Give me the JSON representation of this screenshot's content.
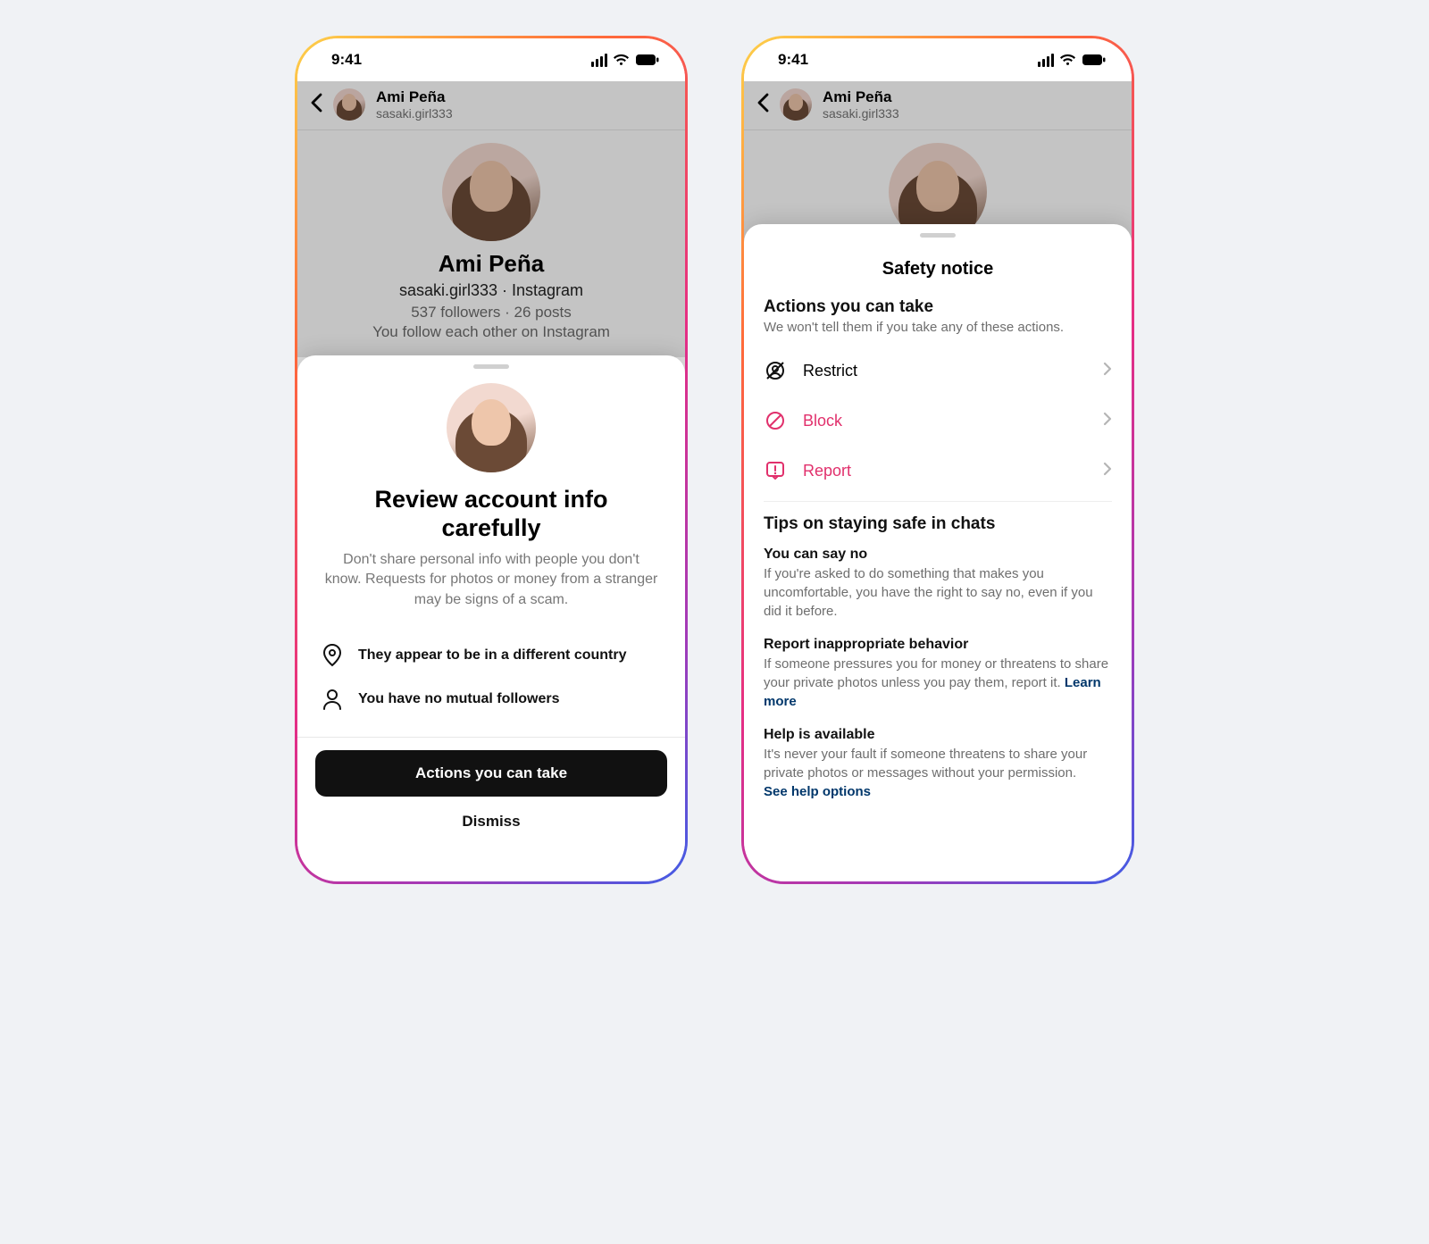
{
  "status": {
    "time": "9:41"
  },
  "profile": {
    "display_name": "Ami Peña",
    "username": "sasaki.girl333",
    "profile_line1": "sasaki.girl333 · Instagram",
    "profile_line2": "537 followers · 26 posts",
    "profile_line3": "You follow each other on Instagram"
  },
  "review_sheet": {
    "title": "Review account info carefully",
    "description": "Don't share personal info with people you don't know. Requests for photos or money from a stranger may be signs of a scam.",
    "facts": [
      "They appear to be in a different country",
      "You have no mutual followers"
    ],
    "primary_button": "Actions you can take",
    "dismiss": "Dismiss"
  },
  "safety_sheet": {
    "title": "Safety notice",
    "actions_header": "Actions you can take",
    "actions_sub": "We won't tell them if you take any of these actions.",
    "actions": {
      "restrict": "Restrict",
      "block": "Block",
      "report": "Report"
    },
    "tips_header": "Tips on staying safe in chats",
    "tips": [
      {
        "title": "You can say no",
        "body": "If you're asked to do something that makes you uncomfortable, you have the right to say no, even if you did it before.",
        "link": ""
      },
      {
        "title": "Report inappropriate behavior",
        "body": "If someone pressures you for money or threatens to share your private photos unless you pay them, report it. ",
        "link": "Learn more"
      },
      {
        "title": "Help is available",
        "body": "It's never your fault if someone threatens to share your private photos or messages without your permission.",
        "link": "See help options"
      }
    ]
  }
}
